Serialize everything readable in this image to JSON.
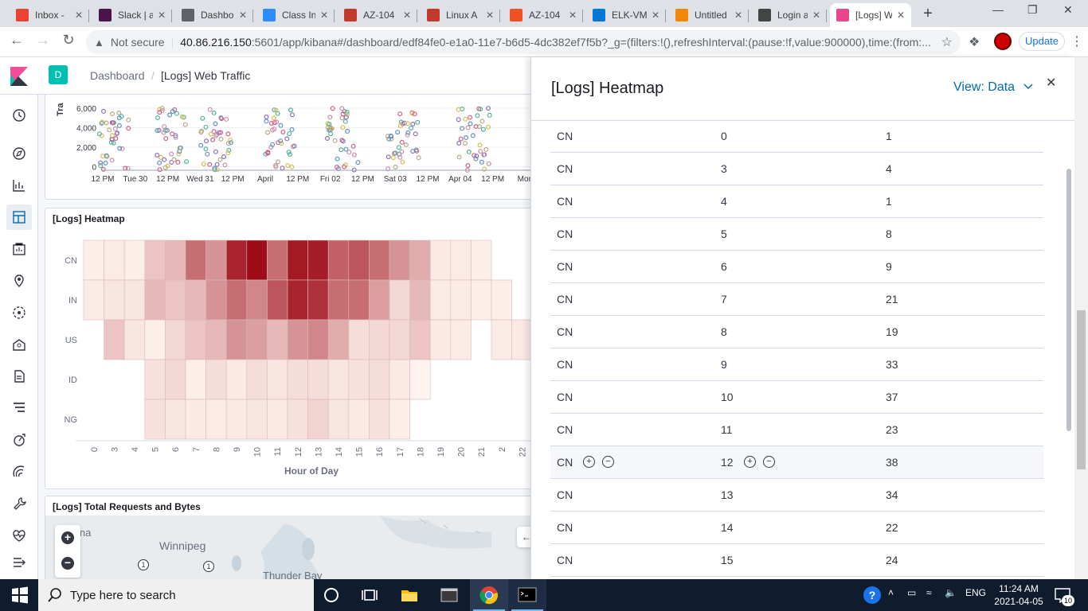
{
  "browser": {
    "tabs": [
      {
        "title": "Inbox - ",
        "icon": "gmail-icon",
        "color": "#ea4335"
      },
      {
        "title": "Slack | a",
        "icon": "slack-icon",
        "color": "#4a154b"
      },
      {
        "title": "Dashbo",
        "icon": "globe-icon",
        "color": "#5f6368"
      },
      {
        "title": "Class In",
        "icon": "zoom-icon",
        "color": "#2d8cff"
      },
      {
        "title": "AZ-104",
        "icon": "udemy-icon",
        "color": "#c0392b"
      },
      {
        "title": "Linux A",
        "icon": "udemy-icon",
        "color": "#c0392b"
      },
      {
        "title": "AZ-104",
        "icon": "microsoft-icon",
        "color": "#f25022"
      },
      {
        "title": "ELK-VM",
        "icon": "azure-icon",
        "color": "#0078d4"
      },
      {
        "title": "Untitled",
        "icon": "drawio-icon",
        "color": "#f08705"
      },
      {
        "title": "Login a",
        "icon": "grafana-icon",
        "color": "#444"
      },
      {
        "title": "[Logs] W",
        "icon": "kibana-icon",
        "color": "#e8488b"
      }
    ],
    "address": {
      "security": "Not secure",
      "host": "40.86.216.150",
      "rest": ":5601/app/kibana#/dashboard/edf84fe0-e1a0-11e7-b6d5-4dc382ef7f5b?_g=(filters:!(),refreshInterval:(pause:!f,value:900000),time:(from:..."
    },
    "update_label": "Update"
  },
  "kibana": {
    "space_badge": "D",
    "breadcrumb": {
      "parent": "Dashboard",
      "separator": "/",
      "current": "[Logs] Web Traffic"
    }
  },
  "scatter": {
    "axis_title": "Tra",
    "y_ticks": [
      "6,000",
      "4,000",
      "2,000",
      "0"
    ],
    "x_ticks": [
      "12 PM",
      "Tue 30",
      "12 PM",
      "Wed 31",
      "12 PM",
      "April",
      "12 PM",
      "Fri 02",
      "12 PM",
      "Sat 03",
      "12 PM",
      "Apr 04",
      "12 PM",
      "Mon"
    ]
  },
  "heatmap": {
    "title": "[Logs] Heatmap",
    "xlabel": "Hour of Day",
    "hours": [
      "0",
      "3",
      "4",
      "5",
      "6",
      "7",
      "8",
      "9",
      "10",
      "11",
      "12",
      "13",
      "14",
      "15",
      "16",
      "17",
      "18",
      "19",
      "20",
      "21",
      "2",
      "22"
    ],
    "countries": [
      "CN",
      "IN",
      "US",
      "ID",
      "NG"
    ],
    "levels": [
      [
        0.03,
        0.04,
        0.03,
        0.2,
        0.25,
        0.55,
        0.4,
        0.85,
        0.95,
        0.55,
        0.9,
        0.88,
        0.6,
        0.65,
        0.55,
        0.4,
        0.3,
        0.05,
        0.04,
        0.03,
        null,
        null
      ],
      [
        0.04,
        0.06,
        0.06,
        0.25,
        0.2,
        0.25,
        0.4,
        0.55,
        0.45,
        0.65,
        0.85,
        0.8,
        0.55,
        0.55,
        0.35,
        0.12,
        0.25,
        0.04,
        0.04,
        0.03,
        0.03,
        null
      ],
      [
        null,
        0.2,
        0.06,
        0.03,
        0.12,
        0.2,
        0.25,
        0.4,
        0.35,
        0.25,
        0.4,
        0.45,
        0.3,
        0.1,
        0.12,
        0.12,
        0.2,
        0.05,
        0.04,
        null,
        0.04,
        0.05
      ],
      [
        null,
        null,
        null,
        0.08,
        0.12,
        0.03,
        0.1,
        0.05,
        0.1,
        0.06,
        0.1,
        0.1,
        0.06,
        0.08,
        0.1,
        0.05,
        0.01,
        null,
        null,
        null,
        null,
        null
      ],
      [
        null,
        null,
        null,
        0.08,
        0.06,
        0.05,
        0.04,
        0.05,
        0.07,
        0.05,
        0.08,
        0.14,
        0.07,
        0.05,
        0.08,
        0.03,
        null,
        null,
        null,
        null,
        null,
        null
      ]
    ]
  },
  "map_panel": {
    "title": "[Logs] Total Requests and Bytes",
    "labels": [
      "ina",
      "Winnipeg",
      "Thunder Bay"
    ],
    "markers": [
      "1",
      "1"
    ]
  },
  "flyout": {
    "title": "[Logs] Heatmap",
    "view": "View: Data",
    "rows": [
      {
        "country": "CN",
        "hour": "0",
        "count": "1"
      },
      {
        "country": "CN",
        "hour": "3",
        "count": "4"
      },
      {
        "country": "CN",
        "hour": "4",
        "count": "1"
      },
      {
        "country": "CN",
        "hour": "5",
        "count": "8"
      },
      {
        "country": "CN",
        "hour": "6",
        "count": "9"
      },
      {
        "country": "CN",
        "hour": "7",
        "count": "21"
      },
      {
        "country": "CN",
        "hour": "8",
        "count": "19"
      },
      {
        "country": "CN",
        "hour": "9",
        "count": "33"
      },
      {
        "country": "CN",
        "hour": "10",
        "count": "37"
      },
      {
        "country": "CN",
        "hour": "11",
        "count": "23"
      },
      {
        "country": "CN",
        "hour": "12",
        "count": "38"
      },
      {
        "country": "CN",
        "hour": "13",
        "count": "34"
      },
      {
        "country": "CN",
        "hour": "14",
        "count": "22"
      },
      {
        "country": "CN",
        "hour": "15",
        "count": "24"
      }
    ],
    "hovered_row": 10
  },
  "taskbar": {
    "search_placeholder": "Type here to search",
    "language": "ENG",
    "time": "11:24 AM",
    "date": "2021-04-05",
    "notification_count": "10"
  }
}
